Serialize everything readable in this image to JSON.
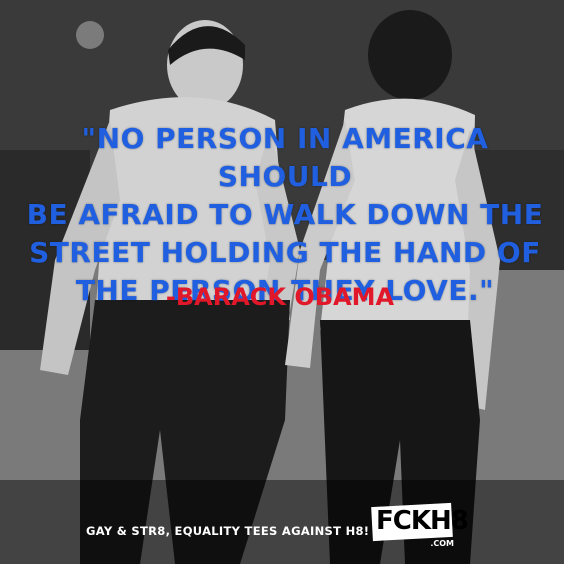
{
  "quote": {
    "lines": [
      "\"No person in America should",
      "be afraid to walk down the",
      "street holding the hand of",
      "the person they love.\""
    ],
    "attribution": "-Barack Obama"
  },
  "footer": {
    "tagline": "GAY & STR8, EQUALITY TEES AGAINST H8!",
    "logo_text": "FCKH8",
    "logo_domain": ".COM"
  },
  "colors": {
    "quote": "#1f5fe0",
    "attribution": "#e0182a"
  }
}
